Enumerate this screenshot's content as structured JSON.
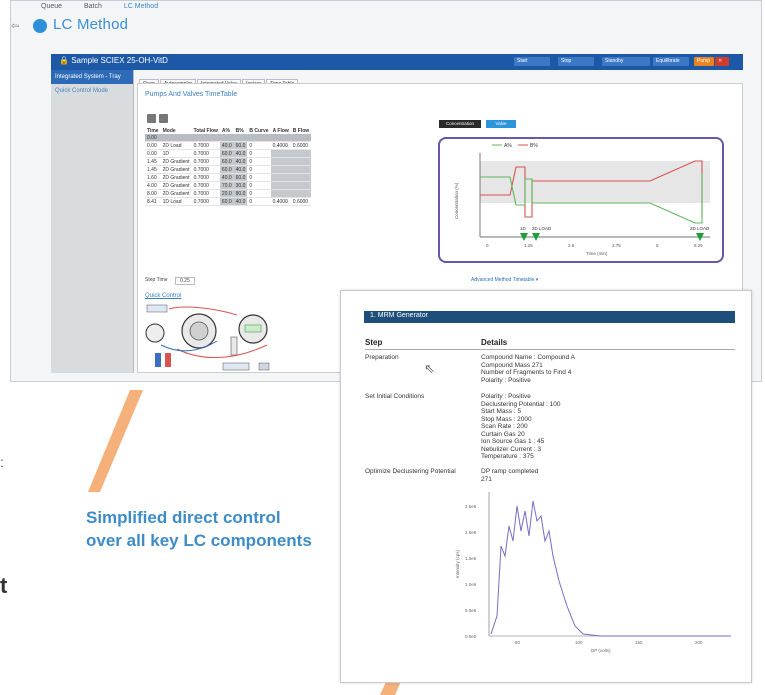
{
  "menu": {
    "items": [
      "Queue",
      "Batch",
      "LC Method"
    ]
  },
  "app": {
    "title": "LC Method",
    "window_title": "Sample SCIEX 25-OH-VitD"
  },
  "toolbar": {
    "buttons": [
      "Start",
      "Stop",
      "Standby",
      "Equilibrate",
      "Pump",
      "Close"
    ]
  },
  "sidebar": {
    "selected": "Integrated System - Tray",
    "item": "Quick Control Mode"
  },
  "tabs": [
    "Oven",
    "Autosampler",
    "Integrated Valve",
    "Ionizer",
    "Time Table"
  ],
  "pump_title": "Pumps And Valves TimeTable",
  "table": {
    "headers": [
      "Time",
      "Mode",
      "Total Flow",
      "A%",
      "B%",
      "B Curve",
      "A Flow",
      "B Flow"
    ],
    "rows": [
      [
        "0.00",
        "",
        "",
        "",
        "",
        "",
        "",
        ""
      ],
      [
        "0.00",
        "2D Load",
        "0.7000",
        "40.0",
        "60.0",
        "0",
        "0.4000",
        "0.6000"
      ],
      [
        "0.00",
        "1D",
        "0.7000",
        "60.0",
        "40.0",
        "0",
        "",
        ""
      ],
      [
        "1.45",
        "2D Gradient",
        "0.7000",
        "60.0",
        "40.0",
        "0",
        "",
        ""
      ],
      [
        "1.45",
        "2D Gradient",
        "0.7000",
        "60.0",
        "40.0",
        "0",
        "",
        ""
      ],
      [
        "1.60",
        "2D Gradient",
        "0.7000",
        "40.0",
        "60.0",
        "0",
        "",
        ""
      ],
      [
        "4.00",
        "2D Gradient",
        "0.7000",
        "70.0",
        "30.0",
        "0",
        "",
        ""
      ],
      [
        "8.00",
        "2D Gradient",
        "0.7000",
        "20.0",
        "80.0",
        "0",
        "",
        ""
      ],
      [
        "8.41",
        "1D Load",
        "0.7000",
        "60.0",
        "40.0",
        "0",
        "0.4000",
        "0.6000"
      ]
    ],
    "step_time_label": "Step Time",
    "step_time_value": "0.25"
  },
  "chart_controls": {
    "dark_button": "Concentration",
    "blue_button": "Valve"
  },
  "chart_legend": [
    "A%",
    "B%"
  ],
  "chart_ylabel": "Concentration (%)",
  "chart_xlabel": "Time (min)",
  "chart_xticks": [
    "0",
    "1.25",
    "2.5",
    "3.75",
    "5",
    "6.25"
  ],
  "chart_markers": [
    "1D",
    "2D LOAD",
    "2D LOAD"
  ],
  "advanced_link": "Advanced Method Timetable",
  "quick_control": "Quick Control",
  "mrm": {
    "title": "1.   MRM Generator",
    "col_step": "Step",
    "col_details": "Details",
    "steps": [
      {
        "step": "Preparation",
        "details": [
          "Compound Name : Compound A",
          "Compound Mass 271",
          "Number of Fragments to Find 4",
          "Polarity : Positive"
        ]
      },
      {
        "step": "Set Initial Conditions",
        "details": [
          "Polarity : Positive",
          "Declustering Potential : 100",
          "Start Mass : 5",
          "Stop Mass : 2000",
          "Scan Rate : 200",
          "Curtain Gas 20",
          "Ion Source Gas 1 : 45",
          "Nebulizer Current : 3",
          "Temperature : 375"
        ]
      },
      {
        "step": "Optimize Declustering Potential",
        "details": [
          "DP ramp completed",
          "271"
        ]
      }
    ],
    "chart_xlabel": "DP (volts)",
    "chart_ylabel": "Intensity (cps)",
    "chart_xticks": [
      "50",
      "100",
      "150",
      "200"
    ],
    "chart_yticks": [
      "0.0e0",
      "5.0e5",
      "1.0e6",
      "1.5e6",
      "2.0e6",
      "2.5e6"
    ]
  },
  "callout": {
    "text": "Simplified direct control over all key LC components"
  },
  "edge": {
    "colon": ":",
    "letter": "t"
  },
  "colors": {
    "accent": "#2f8fd8",
    "titlebar": "#1d58a6",
    "callout": "#f4a46a",
    "purple": "#6b56a8"
  }
}
